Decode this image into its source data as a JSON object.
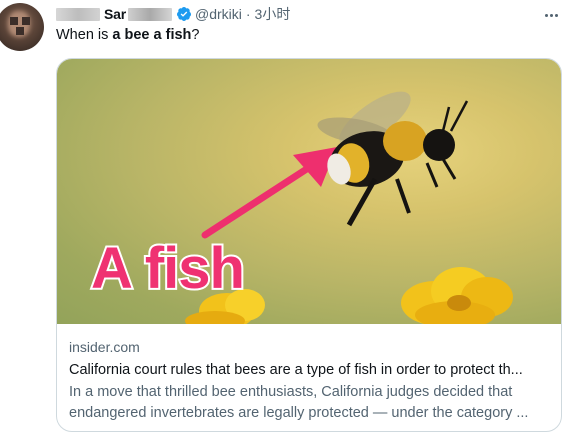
{
  "tweet": {
    "author_name_visible": "Sar",
    "handle": "@drkiki",
    "separator": "·",
    "time": "3小时",
    "text_prefix": "When is ",
    "text_bold": "a bee a fish",
    "text_suffix": "?"
  },
  "card": {
    "image_overlay_text": "A fish",
    "domain": "insider.com",
    "title": "California court rules that bees are a type of fish in order to protect th...",
    "description_line1": "In a move that thrilled bee enthusiasts, California judges decided that",
    "description_line2": "endangered invertebrates are legally protected — under the category ..."
  },
  "colors": {
    "verified": "#1d9bf0",
    "secondary_text": "#536471",
    "border": "#cfd9de",
    "arrow_pink": "#ee2f6e",
    "overlay_text_pink": "#ef3272"
  },
  "icons": [
    "verified-badge-icon",
    "more-icon"
  ]
}
